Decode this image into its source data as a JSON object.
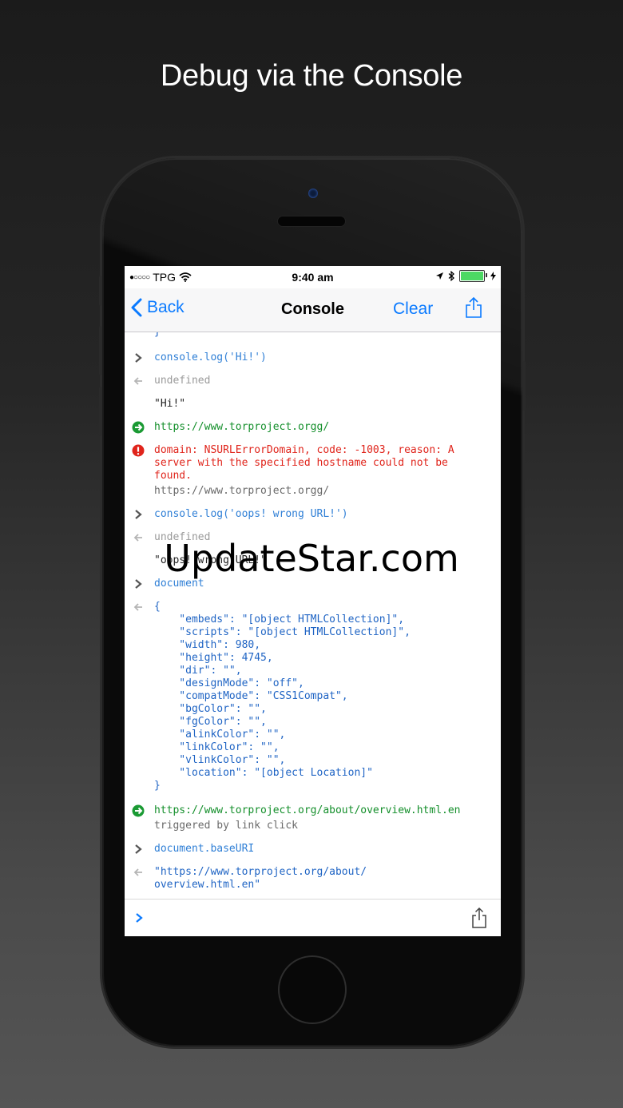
{
  "headline": "Debug via the Console",
  "watermark": "UpdateStar.com",
  "statusbar": {
    "carrier": "TPG",
    "signal": "●○○○○",
    "time": "9:40 am"
  },
  "navbar": {
    "back_label": "Back",
    "title": "Console",
    "clear_label": "Clear"
  },
  "log": {
    "e0": "}",
    "e1": "console.log('Hi!')",
    "e2": "undefined",
    "e3": "\"Hi!\"",
    "e4": "https://www.torproject.orgg/",
    "e5": "domain: NSURLErrorDomain, code: -1003, reason: A\nserver with the specified hostname could not be\nfound.",
    "e5b": "https://www.torproject.orgg/",
    "e6": "console.log('oops! wrong URL!')",
    "e7": "undefined",
    "e8": "\"oops! wrong URL!\"",
    "e9": "document",
    "e10": "{\n    \"embeds\": \"[object HTMLCollection]\",\n    \"scripts\": \"[object HTMLCollection]\",\n    \"width\": 980,\n    \"height\": 4745,\n    \"dir\": \"\",\n    \"designMode\": \"off\",\n    \"compatMode\": \"CSS1Compat\",\n    \"bgColor\": \"\",\n    \"fgColor\": \"\",\n    \"alinkColor\": \"\",\n    \"linkColor\": \"\",\n    \"vlinkColor\": \"\",\n    \"location\": \"[object Location]\"\n}",
    "e11": "https://www.torproject.org/about/overview.html.en",
    "e11b": "triggered by link click",
    "e12": "document.baseURI",
    "e13": "\"https://www.torproject.org/about/\noverview.html.en\""
  },
  "colors": {
    "accent": "#0a7aff",
    "input": "#2f7fd6",
    "navigation": "#148f2b",
    "error": "#e0241b"
  }
}
